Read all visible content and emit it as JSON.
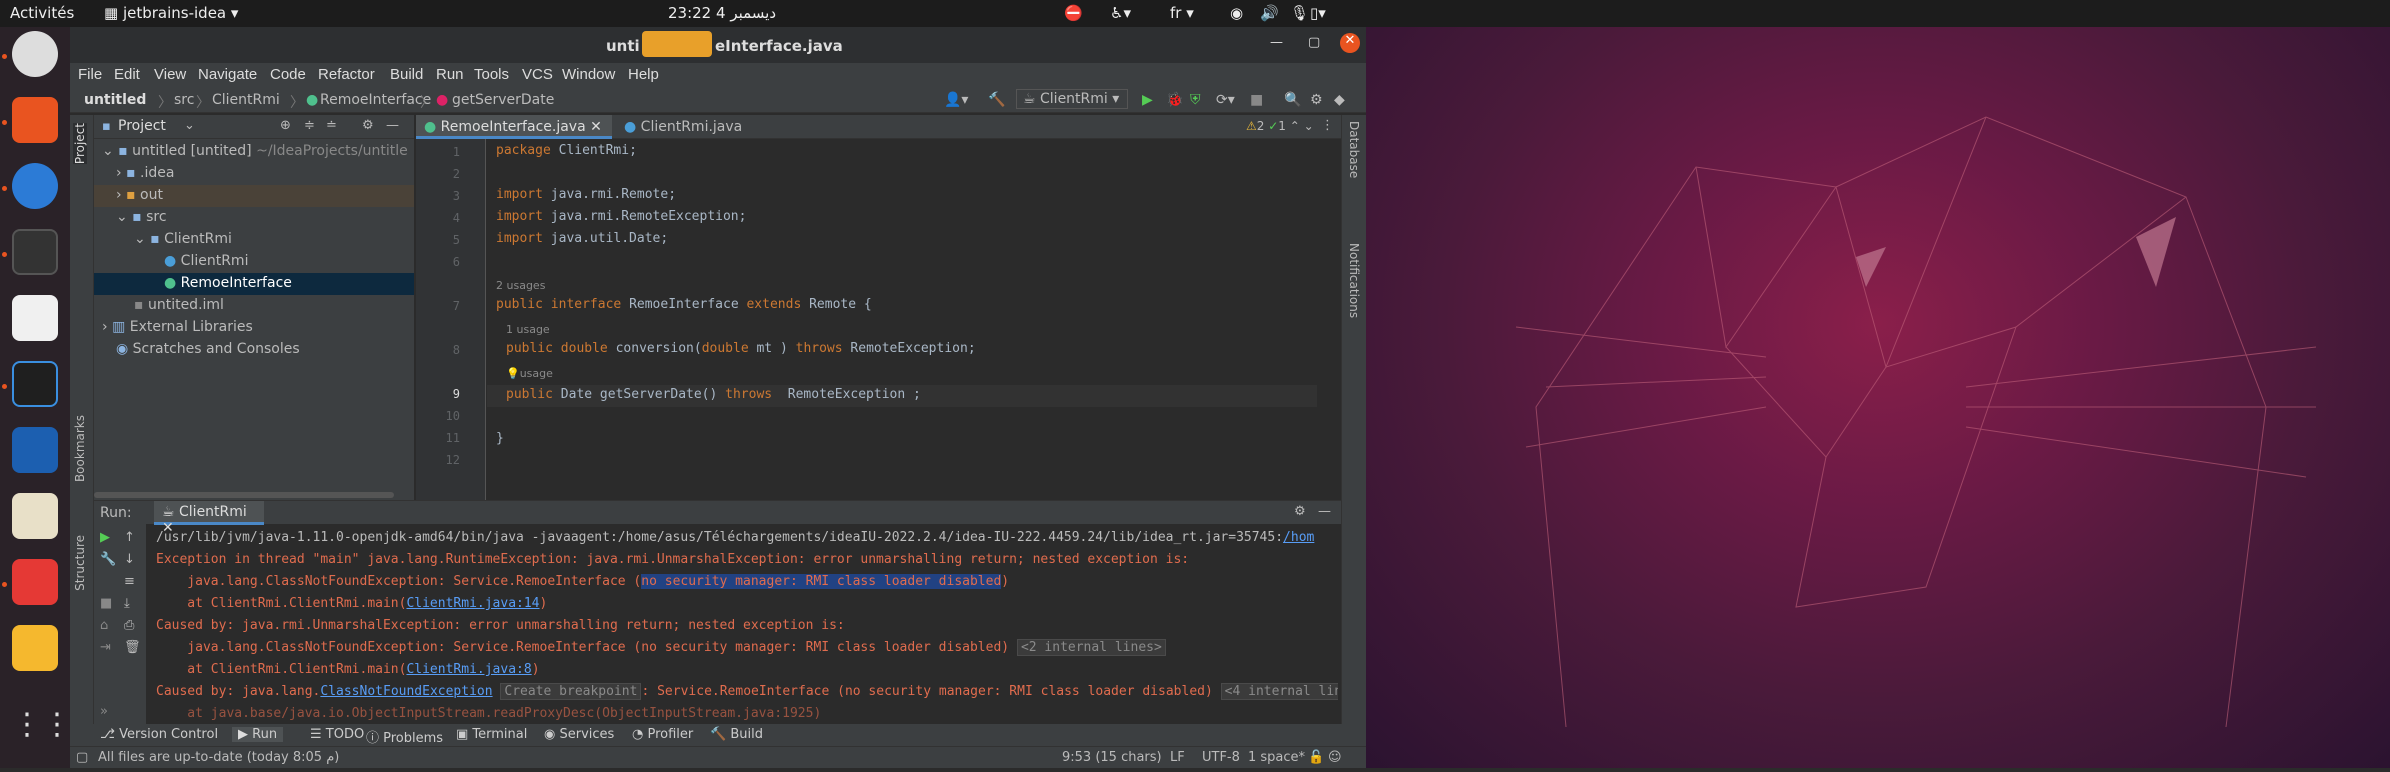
{
  "topbar": {
    "activities": "Activités",
    "app": "jetbrains-idea",
    "clock": "23:22 4 ديسمبر",
    "lang": "fr"
  },
  "window": {
    "title_left": "unti",
    "title_right": "eInterface.java"
  },
  "menu": [
    "File",
    "Edit",
    "View",
    "Navigate",
    "Code",
    "Refactor",
    "Build",
    "Run",
    "Tools",
    "VCS",
    "Window",
    "Help"
  ],
  "nav": {
    "project": "untitled",
    "src": "src",
    "pkg": "ClientRmi",
    "iface": "RemoeInterface",
    "method": "getServerDate",
    "run_config": "ClientRmi"
  },
  "project_panel": {
    "title": "Project",
    "root": "untitled [untited]",
    "root_path": "~/IdeaProjects/untitle",
    "items": [
      ".idea",
      "out",
      "src",
      "ClientRmi",
      "ClientRmi",
      "RemoeInterface",
      "untited.iml",
      "External Libraries",
      "Scratches and Consoles"
    ]
  },
  "tabs": [
    {
      "label": "RemoeInterface.java"
    },
    {
      "label": "ClientRmi.java"
    }
  ],
  "inspection": {
    "warnings": "2",
    "checks": "1"
  },
  "code_hints": {
    "usages2": "2 usages",
    "usage1": "1 usage",
    "usage1b": "usage"
  },
  "code_lines": [
    "package ClientRmi;",
    "",
    "import java.rmi.Remote;",
    "import java.rmi.RemoteException;",
    "import java.util.Date;",
    "",
    "public interface RemoeInterface extends Remote {",
    "public double conversion(double mt ) throws RemoteException;",
    "public Date getServerDate() throws  RemoteException ;",
    "",
    "}",
    ""
  ],
  "line_numbers": [
    "1",
    "2",
    "3",
    "4",
    "5",
    "6",
    "7",
    "8",
    "9",
    "10",
    "11",
    "12"
  ],
  "run": {
    "label": "Run:",
    "config": "ClientRmi",
    "lines": [
      "/usr/lib/jvm/java-1.11.0-openjdk-amd64/bin/java -javaagent:/home/asus/Téléchargements/ideaIU-2022.2.4/idea-IU-222.4459.24/lib/idea_rt.jar=35745:",
      "Exception in thread \"main\" java.lang.RuntimeException: java.rmi.UnmarshalException: error unmarshalling return; nested exception is:",
      "    java.lang.ClassNotFoundException: Service.RemoeInterface (",
      "    at ClientRmi.ClientRmi.main(",
      "Caused by: java.rmi.UnmarshalException: error unmarshalling return; nested exception is:",
      "    java.lang.ClassNotFoundException: Service.RemoeInterface (no security manager: RMI class loader disabled)",
      "    at ClientRmi.ClientRmi.main(",
      "Caused by: java.lang.",
      "    at java.base/java.io.ObjectInputStream.readProxyDesc(ObjectInputStream.java:1925)"
    ],
    "path_link": "/hom",
    "highlight": "no security manager: RMI class loader disabled",
    "link14": "ClientRmi.java:14",
    "link8": "ClientRmi.java:8",
    "internal2": "<2 internal lines>",
    "cnfe": "ClassNotFoundException",
    "create_bp": "Create breakpoint",
    "cause_tail": ": Service.RemoeInterface (no security manager: RMI class loader disabled)",
    "internal4": "<4 internal lines>"
  },
  "bottom_tabs": [
    "Version Control",
    "Run",
    "TODO",
    "Problems",
    "Terminal",
    "Services",
    "Profiler",
    "Build"
  ],
  "status": {
    "left": "All files are up-to-date (today 8:05 م)",
    "pos": "9:53 (15 chars)",
    "lf": "LF",
    "enc": "UTF-8",
    "indent": "1 space*"
  },
  "side_tabs": {
    "project": "Project",
    "bookmarks": "Bookmarks",
    "structure": "Structure",
    "database": "Database",
    "notifications": "Notifications"
  }
}
